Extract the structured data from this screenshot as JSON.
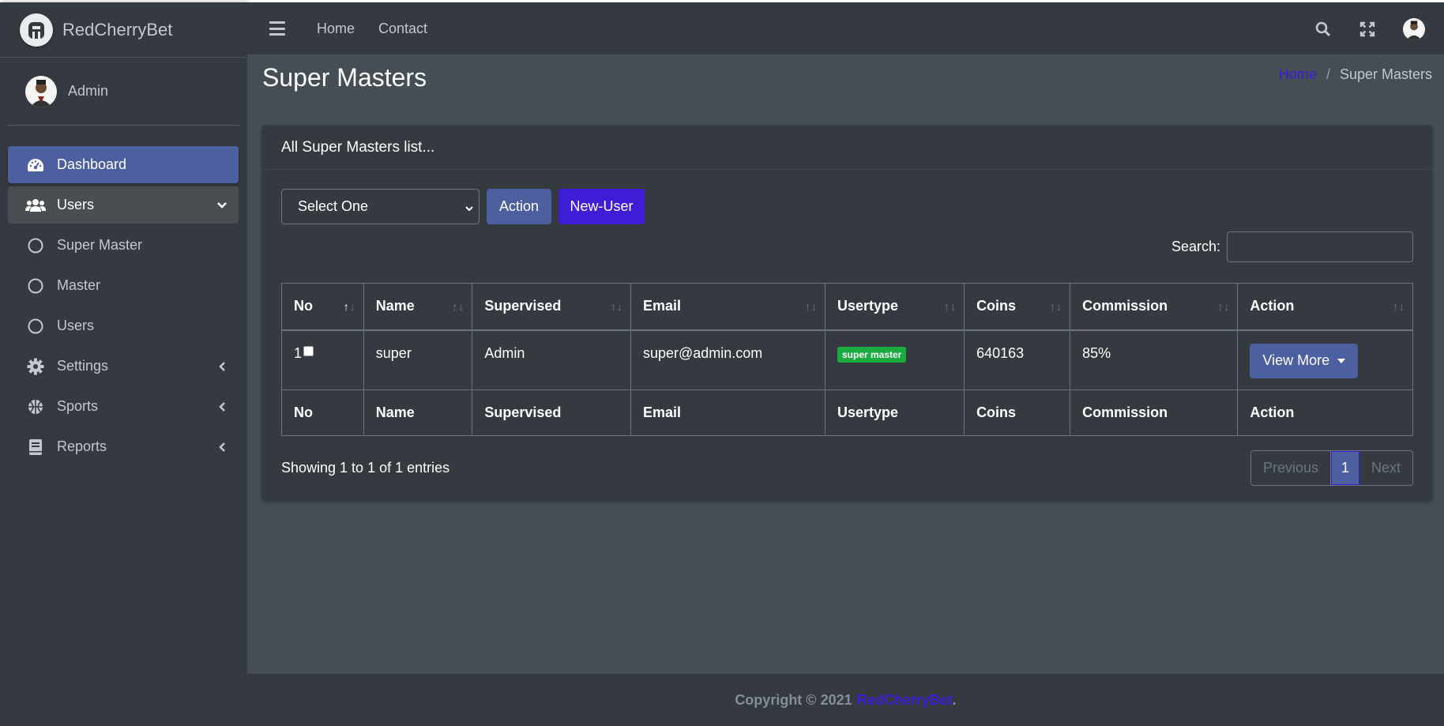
{
  "brand": {
    "name": "RedCherryBet"
  },
  "user_panel": {
    "name": "Admin"
  },
  "sidebar": {
    "items": [
      {
        "label": "Dashboard"
      },
      {
        "label": "Users"
      },
      {
        "label": "Super Master"
      },
      {
        "label": "Master"
      },
      {
        "label": "Users"
      },
      {
        "label": "Settings"
      },
      {
        "label": "Sports"
      },
      {
        "label": "Reports"
      }
    ]
  },
  "navbar": {
    "links": [
      "Home",
      "Contact"
    ]
  },
  "header": {
    "title": "Super Masters",
    "breadcrumb": [
      "Home",
      "/",
      "Super Masters"
    ]
  },
  "card": {
    "title": "All Super Masters list...",
    "select_value": "Select One",
    "action_label": "Action",
    "new_user_label": "New-User",
    "search_label": "Search:"
  },
  "table": {
    "columns": [
      "No",
      "Name",
      "Supervised",
      "Email",
      "Usertype",
      "Coins",
      "Commission",
      "Action"
    ],
    "rows": [
      {
        "no": "1",
        "name": "super",
        "supervised": "Admin",
        "email": "super@admin.com",
        "usertype": "super master",
        "coins": "640163",
        "commission": "85%",
        "action": "View More"
      }
    ],
    "info": "Showing 1 to 1 of 1 entries",
    "pagination": [
      "Previous",
      "1",
      "Next"
    ]
  },
  "footer": {
    "text": "Copyright © 2021",
    "brand": "RedCherryBet",
    "suffix": "."
  },
  "colors": {
    "primary": "#4c5f9f",
    "brand_accent": "#3f1dd6",
    "badge_green": "#1aab3f"
  }
}
